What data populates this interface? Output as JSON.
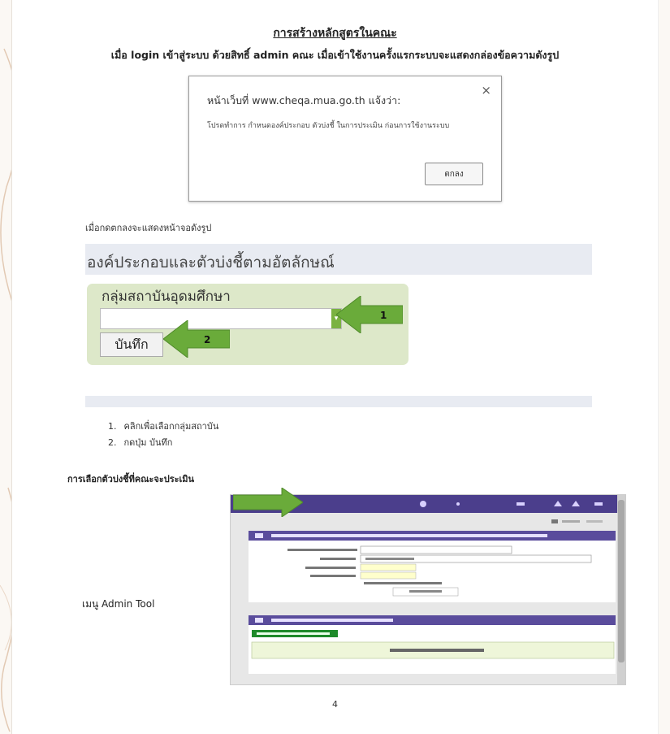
{
  "document": {
    "title": "การสร้างหลักสูตรในคณะ",
    "intro": "เมื่อ login เข้าสู่ระบบ ด้วยสิทธิ์ admin คณะ เมื่อเข้าใช้งานครั้งแรกระบบจะแสดงกล่องข้อความดังรูป",
    "after_ok": "เมื่อกดตกลงจะแสดงหน้าจอดังรูป",
    "section_heading": "การเลือกตัวบ่งชี้ที่คณะจะประเมิน",
    "menu_label": "เมนู Admin Tool",
    "page_number": "4"
  },
  "dialog": {
    "header": "หน้าเว็บที่ www.cheqa.mua.go.th แจ้งว่า:",
    "message": "โปรดทำการ กำหนดองค์ประกอบ ตัวบ่งชี้ ในการประเมิน ก่อนการใช้งานระบบ",
    "ok_label": "ตกลง",
    "close_symbol": "×"
  },
  "form": {
    "band_title": "องค์ประกอบและตัวบ่งชี้ตามอัตลักษณ์",
    "group_label": "กลุ่มสถาบันอุดมศึกษา",
    "select_value": "",
    "save_label": "บันทึก",
    "callout_1": "1",
    "callout_2": "2"
  },
  "steps": [
    {
      "num": "1.",
      "text": "คลิกเพื่อเลือกกลุ่มสถาบัน"
    },
    {
      "num": "2.",
      "text": "กดปุ่ม บันทึก"
    }
  ],
  "colors": {
    "arrow_green": "#6aab3a",
    "admin_header": "#4b3e8c",
    "group_bg": "#dde8c9",
    "band_bg": "#e8ebf2"
  }
}
